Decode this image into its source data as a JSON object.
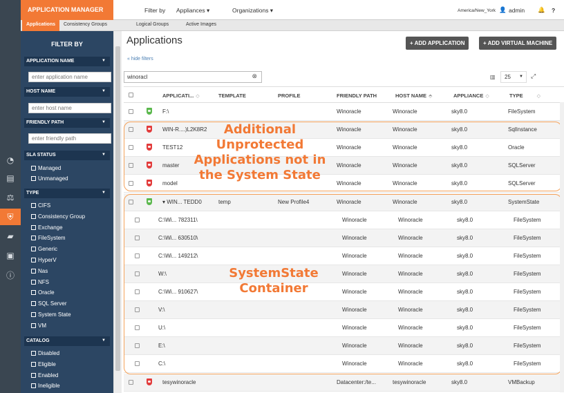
{
  "header": {
    "app_title": "APPLICATION MANAGER",
    "filter_by": "Filter by",
    "appliances": "Appliances ▾",
    "organizations": "Organizations ▾",
    "timezone": "America/New_York",
    "user": "admin"
  },
  "subnav": [
    "Applications",
    "Consistency Groups",
    "Logical Groups",
    "Active Images"
  ],
  "sidebar_filters": {
    "title": "FILTER BY",
    "application_name": {
      "label": "APPLICATION NAME",
      "placeholder": "enter application name"
    },
    "host_name": {
      "label": "HOST NAME",
      "placeholder": "enter host name"
    },
    "friendly_path": {
      "label": "FRIENDLY PATH",
      "placeholder": "enter friendly path"
    },
    "sla_status": {
      "label": "SLA STATUS",
      "options": [
        "Managed",
        "Unmanaged"
      ]
    },
    "type": {
      "label": "TYPE",
      "options": [
        "CIFS",
        "Consistency Group",
        "Exchange",
        "FileSystem",
        "Generic",
        "HyperV",
        "Nas",
        "NFS",
        "Oracle",
        "SQL Server",
        "System State",
        "VM"
      ]
    },
    "catalog": {
      "label": "CATALOG",
      "options": [
        "Disabled",
        "Eligible",
        "Enabled",
        "Ineligible"
      ]
    }
  },
  "main": {
    "title": "Applications",
    "hide_filters": "« hide filters",
    "add_application": "+ ADD APPLICATION",
    "add_vm": "+ ADD VIRTUAL MACHINE",
    "search_value": "winoracl",
    "page_size": "25",
    "columns": [
      "APPLICATI...",
      "TEMPLATE",
      "PROFILE",
      "FRIENDLY PATH",
      "HOST NAME",
      "APPLIANCE",
      "TYPE"
    ]
  },
  "rows": [
    {
      "name": "F:\\",
      "template": "",
      "profile": "",
      "path": "Winoracle",
      "host": "Winoracle",
      "appliance": "sky8.0",
      "type": "FileSystem",
      "status": "protected"
    },
    {
      "name": "WIN-R....)L2K8R2",
      "template": "",
      "profile": "",
      "path": "Winoracle",
      "host": "Winoracle",
      "appliance": "sky8.0",
      "type": "SqlInstance",
      "status": "unprotected"
    },
    {
      "name": "TEST12",
      "template": "",
      "profile": "",
      "path": "Winoracle",
      "host": "Winoracle",
      "appliance": "sky8.0",
      "type": "Oracle",
      "status": "unprotected"
    },
    {
      "name": "master",
      "template": "",
      "profile": "",
      "path": "Winoracle",
      "host": "Winoracle",
      "appliance": "sky8.0",
      "type": "SQLServer",
      "status": "unprotected"
    },
    {
      "name": "model",
      "template": "",
      "profile": "",
      "path": "Winoracle",
      "host": "Winoracle",
      "appliance": "sky8.0",
      "type": "SQLServer",
      "status": "unprotected"
    },
    {
      "name": "▾ WIN... TEDD0",
      "template": "temp",
      "profile": "New Profile4",
      "path": "Winoracle",
      "host": "Winoracle",
      "appliance": "sky8.0",
      "type": "SystemState",
      "status": "protected"
    },
    {
      "name": "C:\\Wi... 782311\\",
      "path": "Winoracle",
      "host": "Winoracle",
      "appliance": "sky8.0",
      "type": "FileSystem",
      "status": "child"
    },
    {
      "name": "C:\\Wi... 630510\\",
      "path": "Winoracle",
      "host": "Winoracle",
      "appliance": "sky8.0",
      "type": "FileSystem",
      "status": "child"
    },
    {
      "name": "C:\\Wi... 149212\\",
      "path": "Winoracle",
      "host": "Winoracle",
      "appliance": "sky8.0",
      "type": "FileSystem",
      "status": "child"
    },
    {
      "name": "W:\\",
      "path": "Winoracle",
      "host": "Winoracle",
      "appliance": "sky8.0",
      "type": "FileSystem",
      "status": "child"
    },
    {
      "name": "C:\\Wi... 910627\\",
      "path": "Winoracle",
      "host": "Winoracle",
      "appliance": "sky8.0",
      "type": "FileSystem",
      "status": "child"
    },
    {
      "name": "V:\\",
      "path": "Winoracle",
      "host": "Winoracle",
      "appliance": "sky8.0",
      "type": "FileSystem",
      "status": "child"
    },
    {
      "name": "U:\\",
      "path": "Winoracle",
      "host": "Winoracle",
      "appliance": "sky8.0",
      "type": "FileSystem",
      "status": "child"
    },
    {
      "name": "E:\\",
      "path": "Winoracle",
      "host": "Winoracle",
      "appliance": "sky8.0",
      "type": "FileSystem",
      "status": "child"
    },
    {
      "name": "C:\\",
      "path": "Winoracle",
      "host": "Winoracle",
      "appliance": "sky8.0",
      "type": "FileSystem",
      "status": "child"
    },
    {
      "name": "tesywinoracle",
      "template": "",
      "profile": "",
      "path": "Datacenter:/te...",
      "host": "tesywinoracle",
      "appliance": "sky8.0",
      "type": "VMBackup",
      "status": "unprotected"
    }
  ],
  "annotations": {
    "unprotected": [
      "Additional",
      "Unprotected",
      "Applications not in",
      "the System State"
    ],
    "container": [
      "SystemState",
      "Container"
    ]
  },
  "colors": {
    "accent": "#f27935",
    "sidebar": "#2c4663",
    "rail": "#3a4651",
    "protected": "#5bb84d",
    "unprotected": "#e23b3b"
  }
}
